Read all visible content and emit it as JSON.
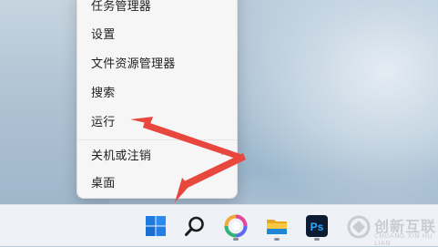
{
  "context_menu": {
    "items": [
      {
        "label": "任务管理器"
      },
      {
        "label": "设置"
      },
      {
        "label": "文件资源管理器"
      },
      {
        "label": "搜索"
      },
      {
        "label": "运行"
      },
      {
        "label": "关机或注销",
        "submenu": true
      },
      {
        "label": "桌面"
      }
    ],
    "submenu_chevron": "›"
  },
  "taskbar": {
    "icons": [
      {
        "name": "windows-start-icon"
      },
      {
        "name": "search-icon"
      },
      {
        "name": "copilot-icon"
      },
      {
        "name": "file-explorer-icon"
      },
      {
        "name": "photoshop-icon",
        "text": "Ps"
      }
    ]
  },
  "annotation": {
    "arrow_color": "#e8473d"
  },
  "watermark": {
    "text": "创新互联",
    "subtext": "CHUANG XIN HU LIAN"
  }
}
